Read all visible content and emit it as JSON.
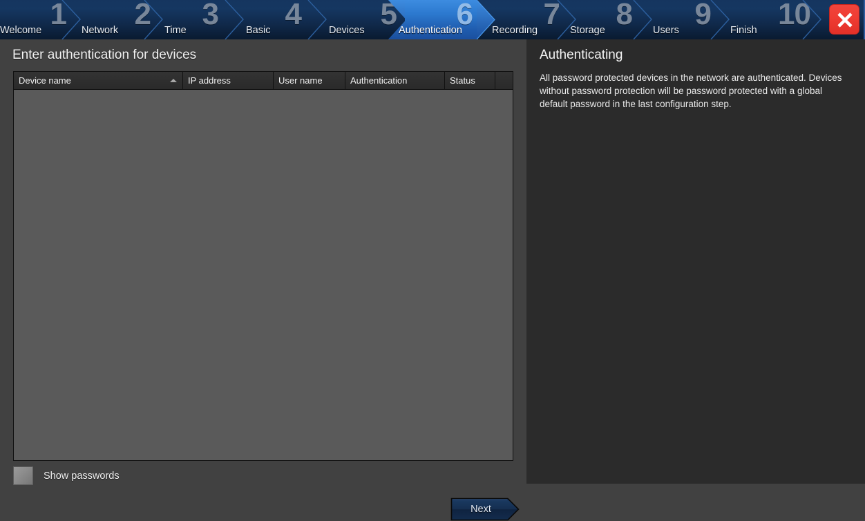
{
  "wizard": {
    "steps": [
      {
        "number": "1",
        "label": "Welcome",
        "active": false
      },
      {
        "number": "2",
        "label": "Network",
        "active": false
      },
      {
        "number": "3",
        "label": "Time",
        "active": false
      },
      {
        "number": "4",
        "label": "Basic",
        "active": false
      },
      {
        "number": "5",
        "label": "Devices",
        "active": false
      },
      {
        "number": "6",
        "label": "Authentication",
        "active": true
      },
      {
        "number": "7",
        "label": "Recording",
        "active": false
      },
      {
        "number": "8",
        "label": "Storage",
        "active": false
      },
      {
        "number": "9",
        "label": "Users",
        "active": false
      },
      {
        "number": "10",
        "label": "Finish",
        "active": false
      }
    ],
    "close_icon": "close-icon",
    "active_step_number": "6",
    "total_steps": "10",
    "colors": {
      "header_top": "#15355f",
      "header_bottom": "#091a30",
      "active_top": "#3d8ce0",
      "active_bottom": "#1a4f9e",
      "step_number": "#8a96a6",
      "close_button": "#ef3c33"
    }
  },
  "main": {
    "title": "Enter authentication for devices",
    "table": {
      "columns": [
        {
          "label": "Device name",
          "sort": "ascending",
          "sort_icon": "sort-ascending-icon"
        },
        {
          "label": "IP address",
          "sort": "none",
          "sort_icon": ""
        },
        {
          "label": "User name",
          "sort": "none",
          "sort_icon": ""
        },
        {
          "label": "Authentication",
          "sort": "none",
          "sort_icon": ""
        },
        {
          "label": "Status",
          "sort": "none",
          "sort_icon": ""
        },
        {
          "label": "",
          "sort": "none",
          "sort_icon": ""
        }
      ],
      "rows": [],
      "empty": true
    },
    "show_passwords": {
      "label": "Show passwords",
      "checked": false
    },
    "next_button": {
      "label": "Next"
    }
  },
  "help": {
    "title": "Authenticating",
    "paragraphs": [
      "All password protected devices in the network are authenticated. Devices without password protection will be password protected with a global default password in the last configuration step."
    ]
  }
}
